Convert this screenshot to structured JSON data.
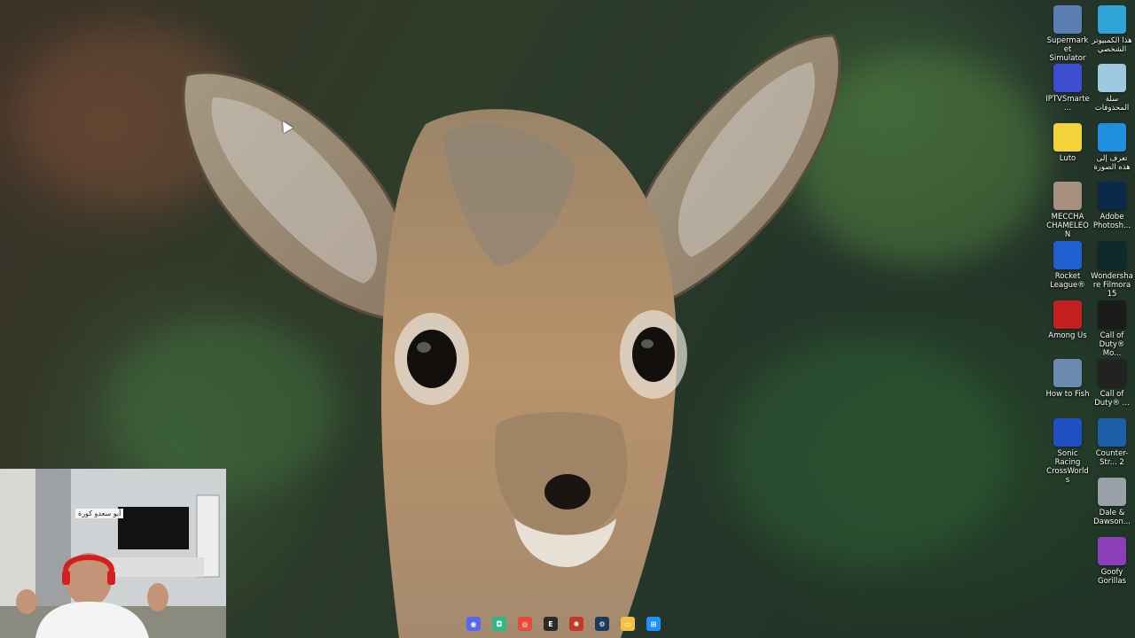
{
  "desktop_icons": [
    {
      "label": "Supermarket Simulator",
      "icon": "supermarket-icon",
      "color": "#5a7fb0"
    },
    {
      "label": "هذا الكمبيوتر الشخصي",
      "icon": "this-pc-icon",
      "color": "#2fa3d6"
    },
    {
      "label": "IPTVSmarte...",
      "icon": "iptv-icon",
      "color": "#3d4fd0"
    },
    {
      "label": "سلة المحذوفات",
      "icon": "recycle-bin-icon",
      "color": "#9ec8e0"
    },
    {
      "label": "Luto",
      "icon": "luto-icon",
      "color": "#f2d33a"
    },
    {
      "label": "تعرف إلى هذه الصورة",
      "icon": "spotlight-icon",
      "color": "#1f8fe0"
    },
    {
      "label": "MECCHA CHAMELEON",
      "icon": "meccha-icon",
      "color": "#a89080"
    },
    {
      "label": "Adobe Photosh...",
      "icon": "photoshop-icon",
      "color": "#0b2a4a"
    },
    {
      "label": "Rocket League®",
      "icon": "rocket-league-icon",
      "color": "#1f5fd0"
    },
    {
      "label": "Wondershare Filmora 15",
      "icon": "filmora-icon",
      "color": "#0e2a2a"
    },
    {
      "label": "Among Us",
      "icon": "among-us-icon",
      "color": "#c41f1f"
    },
    {
      "label": "Call of Duty® Mo...",
      "icon": "cod-mw3-icon",
      "color": "#1b1b1b"
    },
    {
      "label": "How to Fish",
      "icon": "how-to-fish-icon",
      "color": "#6a8ab0"
    },
    {
      "label": "Call of Duty® ...",
      "icon": "cod-mw-icon",
      "color": "#222"
    },
    {
      "label": "Sonic Racing CrossWorlds",
      "icon": "sonic-icon",
      "color": "#1f4fc0"
    },
    {
      "label": "Counter-Str... 2",
      "icon": "cs2-icon",
      "color": "#1c5fa8"
    },
    {
      "label": "Dale & Dawson...",
      "icon": "dale-dawson-icon",
      "color": "#9aa0a8"
    },
    {
      "label": "Goofy Gorillas",
      "icon": "goofy-gorillas-icon",
      "color": "#8a3fb8"
    }
  ],
  "taskbar": [
    {
      "name": "discord",
      "icon": "discord-icon",
      "color": "#5865f2",
      "glyph": "◉"
    },
    {
      "name": "app-green",
      "icon": "messenger-green-icon",
      "color": "#2bb98a",
      "glyph": "◘"
    },
    {
      "name": "chrome",
      "icon": "chrome-icon",
      "color": "#e64a3b",
      "glyph": "◎"
    },
    {
      "name": "epic",
      "icon": "epic-games-icon",
      "color": "#2a2a2a",
      "glyph": "E"
    },
    {
      "name": "game",
      "icon": "game-icon",
      "color": "#c0392b",
      "glyph": "✺"
    },
    {
      "name": "steam",
      "icon": "steam-icon",
      "color": "#1b3a5c",
      "glyph": "⚙"
    },
    {
      "name": "explorer",
      "icon": "file-explorer-icon",
      "color": "#f3c242",
      "glyph": "▭"
    },
    {
      "name": "start",
      "icon": "windows-icon",
      "color": "#1e90ff",
      "glyph": "⊞"
    }
  ],
  "webcam": {
    "sign_text": "أبو سعدو كورة"
  }
}
